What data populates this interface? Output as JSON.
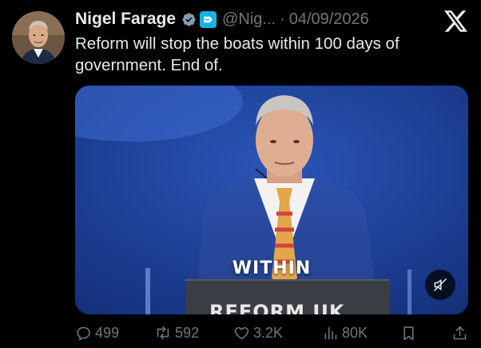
{
  "tweet": {
    "author": {
      "name": "Nigel Farage",
      "handle": "@Nig...",
      "verified": true,
      "affiliate_badge_icon": "reform-badge-icon"
    },
    "separator": "·",
    "date": "04/09/2026",
    "text": "Reform will stop the boats within 100 days of government. End of.",
    "media": {
      "type": "video",
      "caption": "WITHIN",
      "podium_text": "REFORM UK",
      "muted": true
    },
    "actions": {
      "replies": "499",
      "reposts": "592",
      "likes": "3.2K",
      "views": "80K"
    }
  },
  "colors": {
    "background": "#000000",
    "text_primary": "#e7e9ea",
    "text_secondary": "#71767b",
    "verified_badge": "#829aab",
    "affiliate_badge": "#12b4e6",
    "stage_blue": "#1f3f95"
  }
}
